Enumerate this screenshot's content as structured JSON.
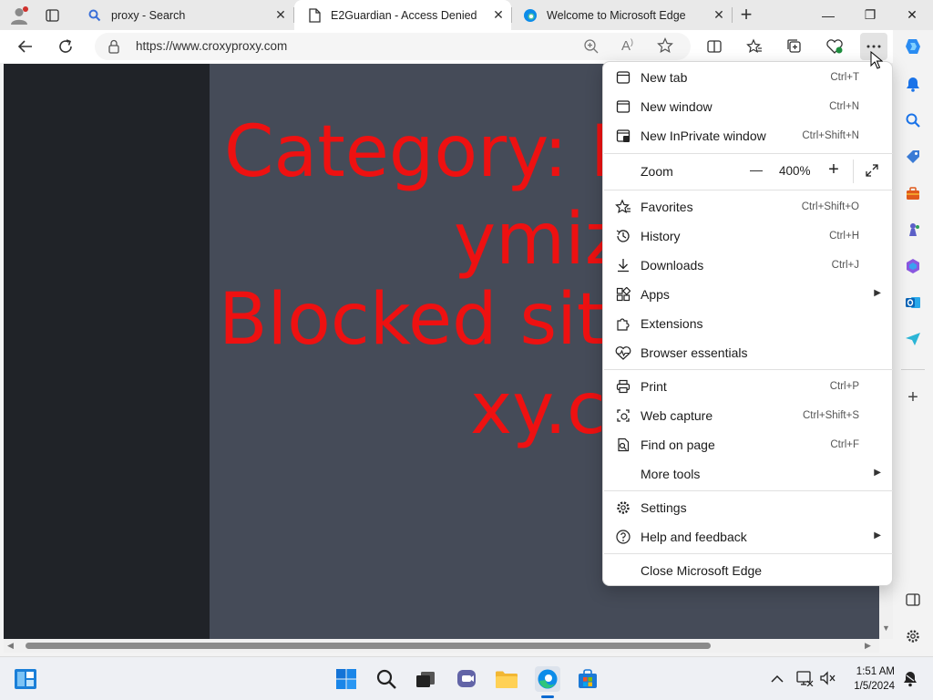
{
  "tabs": [
    {
      "title": "proxy - Search",
      "close": "✕"
    },
    {
      "title": "E2Guardian - Access Denied",
      "close": "✕"
    },
    {
      "title": "Welcome to Microsoft Edge",
      "close": "✕"
    }
  ],
  "new_tab_symbol": "+",
  "window_controls": {
    "minimize": "—",
    "maximize": "❐",
    "close": "✕"
  },
  "address": {
    "url": "https://www.croxyproxy.com"
  },
  "page_text": {
    "line1": "Category: P",
    "line2": "ymiz",
    "line3": "Blocked site",
    "line4": "xy.co"
  },
  "menu": {
    "new_tab": {
      "label": "New tab",
      "shortcut": "Ctrl+T"
    },
    "new_window": {
      "label": "New window",
      "shortcut": "Ctrl+N"
    },
    "new_inprivate": {
      "label": "New InPrivate window",
      "shortcut": "Ctrl+Shift+N"
    },
    "zoom": {
      "label": "Zoom",
      "minus": "—",
      "value": "400%",
      "plus": "+"
    },
    "favorites": {
      "label": "Favorites",
      "shortcut": "Ctrl+Shift+O"
    },
    "history": {
      "label": "History",
      "shortcut": "Ctrl+H"
    },
    "downloads": {
      "label": "Downloads",
      "shortcut": "Ctrl+J"
    },
    "apps": {
      "label": "Apps"
    },
    "extensions": {
      "label": "Extensions"
    },
    "browser_essentials": {
      "label": "Browser essentials"
    },
    "print": {
      "label": "Print",
      "shortcut": "Ctrl+P"
    },
    "web_capture": {
      "label": "Web capture",
      "shortcut": "Ctrl+Shift+S"
    },
    "find_on_page": {
      "label": "Find on page",
      "shortcut": "Ctrl+F"
    },
    "more_tools": {
      "label": "More tools"
    },
    "settings": {
      "label": "Settings"
    },
    "help_feedback": {
      "label": "Help and feedback"
    },
    "close_edge": {
      "label": "Close Microsoft Edge"
    },
    "submenu_arrow": "▶"
  },
  "clock": {
    "time": "1:51 AM",
    "date": "1/5/2024"
  },
  "colors": {
    "blocked_text": "#ee1111",
    "page_bg": "#454b58",
    "left_panel": "#202328",
    "edge_accent": "#0c8ce9"
  }
}
